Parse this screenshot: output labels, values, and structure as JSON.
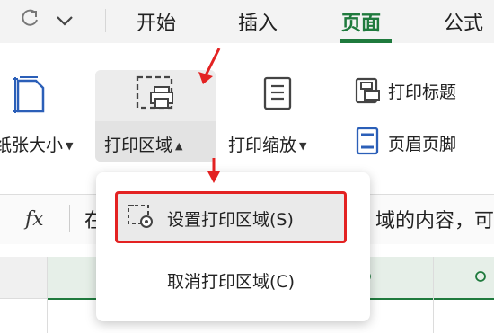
{
  "toolbar": {
    "redo_icon": "redo-icon",
    "dropdown_icon": "chevron-down-icon"
  },
  "tabs": [
    {
      "label": "开始",
      "active": false
    },
    {
      "label": "插入",
      "active": false
    },
    {
      "label": "页面",
      "active": true
    },
    {
      "label": "公式",
      "active": false
    }
  ],
  "ribbon": {
    "paper_size_label": "纸张大小",
    "print_area_label": "打印区域",
    "print_scale_label": "打印缩放",
    "print_titles_label": "打印标题",
    "header_footer_label": "页眉页脚"
  },
  "formula_bar": {
    "fx_label": "fx",
    "content_left": "在",
    "content_right": "域的内容，可"
  },
  "menu": {
    "set_print_area": "设置打印区域(S)",
    "cancel_print_area": "取消打印区域(C)"
  },
  "colors": {
    "accent_green": "#1f7a3d",
    "annotation_red": "#e32222"
  }
}
